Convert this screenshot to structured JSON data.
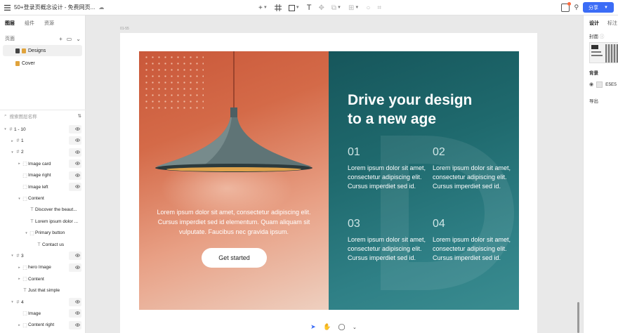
{
  "topbar": {
    "doc_title": "50+登录页概念设计 - 免费网页...",
    "share_label": "分享"
  },
  "left_panel": {
    "tabs": [
      {
        "label": "图层",
        "active": true
      },
      {
        "label": "组件",
        "active": false
      },
      {
        "label": "资源",
        "active": false
      }
    ],
    "pages_label": "页面",
    "pages": [
      {
        "label": "Designs",
        "selected": true
      },
      {
        "label": "Cover",
        "selected": false
      }
    ],
    "search_placeholder": "搜索图层名称",
    "layers": [
      {
        "name": "1 - 10",
        "depth": 0,
        "icon": "frame-icon",
        "expand": "down",
        "eye": true
      },
      {
        "name": "1",
        "depth": 1,
        "icon": "frame-icon",
        "expand": "right",
        "eye": true
      },
      {
        "name": "2",
        "depth": 1,
        "icon": "frame-icon",
        "expand": "down",
        "eye": true
      },
      {
        "name": "Image card",
        "depth": 2,
        "icon": "group-icon",
        "expand": "right",
        "eye": true
      },
      {
        "name": "Image right",
        "depth": 2,
        "icon": "group-icon",
        "expand": "",
        "eye": true
      },
      {
        "name": "Image left",
        "depth": 2,
        "icon": "group-icon",
        "expand": "",
        "eye": true
      },
      {
        "name": "Content",
        "depth": 2,
        "icon": "group-icon",
        "expand": "down",
        "eye": false
      },
      {
        "name": "Discover the beaut...",
        "depth": 3,
        "icon": "text-icon",
        "expand": "",
        "eye": false
      },
      {
        "name": "Lorem ipsum dolor ...",
        "depth": 3,
        "icon": "text-icon",
        "expand": "",
        "eye": false
      },
      {
        "name": "Primary button",
        "depth": 3,
        "icon": "group-icon",
        "expand": "down",
        "eye": false
      },
      {
        "name": "Contact us",
        "depth": 4,
        "icon": "text-icon",
        "expand": "",
        "eye": false
      },
      {
        "name": "3",
        "depth": 1,
        "icon": "frame-icon",
        "expand": "down",
        "eye": true
      },
      {
        "name": "hero Image",
        "depth": 2,
        "icon": "group-icon",
        "expand": "right",
        "eye": true
      },
      {
        "name": "Content",
        "depth": 2,
        "icon": "group-icon",
        "expand": "right",
        "eye": false
      },
      {
        "name": "Just that simple",
        "depth": 2,
        "icon": "text-icon",
        "expand": "",
        "eye": false
      },
      {
        "name": "4",
        "depth": 1,
        "icon": "frame-icon",
        "expand": "down",
        "eye": true
      },
      {
        "name": "Image",
        "depth": 2,
        "icon": "group-icon",
        "expand": "",
        "eye": true
      },
      {
        "name": "Content right",
        "depth": 2,
        "icon": "group-icon",
        "expand": "right",
        "eye": true
      }
    ]
  },
  "canvas": {
    "frame_label": "01-55",
    "hero": {
      "caption": "Lorem ipsum dolor sit amet, consectetur adipiscing elit. Cursus imperdiet sed id elementum. Quam aliquam sit vulputate. Faucibus nec gravida ipsum.",
      "cta_label": "Get started",
      "headline_line1": "Drive your design",
      "headline_line2": "to a new age",
      "features": [
        {
          "num": "01",
          "text": "Lorem ipsum dolor sit amet, consectetur adipiscing elit. Cursus imperdiet sed id."
        },
        {
          "num": "02",
          "text": "Lorem ipsum dolor sit amet, consectetur adipiscing elit. Cursus imperdiet sed id."
        },
        {
          "num": "03",
          "text": "Lorem ipsum dolor sit amet, consectetur adipiscing elit. Cursus imperdiet sed id."
        },
        {
          "num": "04",
          "text": "Lorem ipsum dolor sit amet, consectetur adipiscing elit. Cursus imperdiet sed id."
        }
      ]
    }
  },
  "right_panel": {
    "tabs": [
      {
        "label": "设计",
        "active": true
      },
      {
        "label": "标注",
        "active": false
      }
    ],
    "cover_label": "封面",
    "background_label": "背景",
    "background_hex": "E5E5",
    "export_label": "导出"
  },
  "colors": {
    "accent": "#3b6cf6",
    "hero_orange": "#c9583a",
    "hero_teal": "#1f6a6e"
  }
}
